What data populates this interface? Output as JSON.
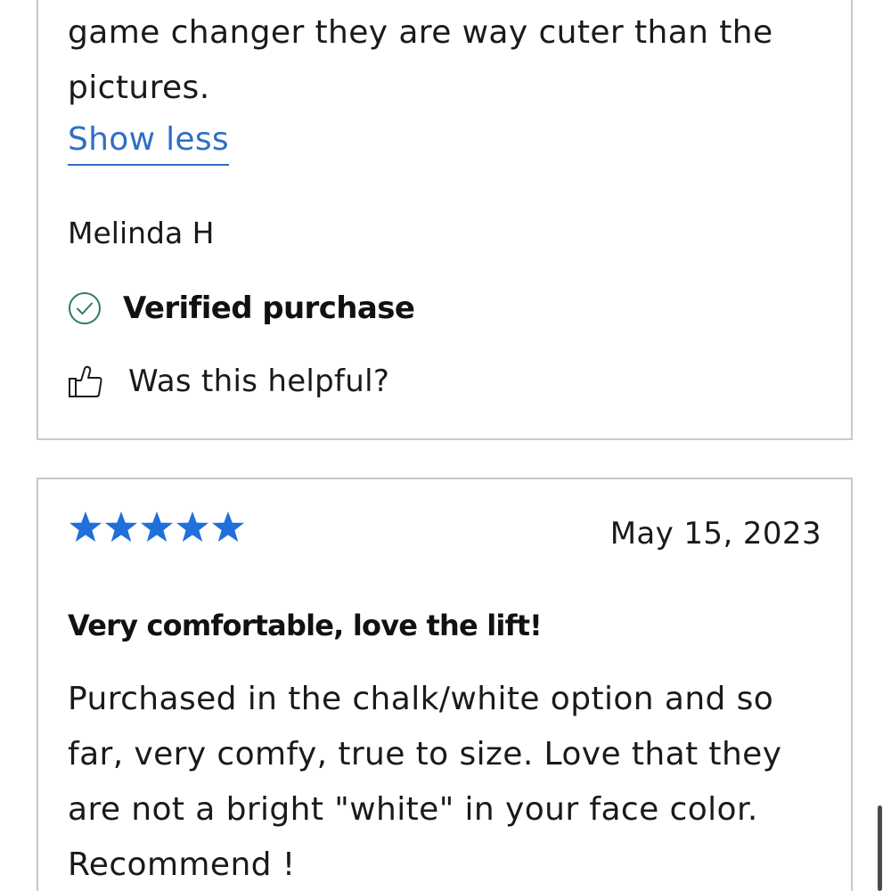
{
  "reviews": [
    {
      "body_tail": "game changer they are way cuter than the pictures.",
      "show_less_label": "Show less",
      "reviewer": "Melinda H",
      "verified_label": "Verified purchase",
      "helpful_label": "Was this helpful?",
      "icons": {
        "verified": "check-circle-icon",
        "helpful": "thumbs-up-icon"
      }
    },
    {
      "rating": 5,
      "rating_max": 5,
      "date": "May 15, 2023",
      "title": "Very comfortable, love the lift!",
      "body": "Purchased in the chalk/white option and so far, very comfy, true to size. Love that they are not a bright \"white\" in your face color. Recommend !"
    }
  ],
  "colors": {
    "link": "#2f6fc4",
    "star": "#1f6fdc",
    "verified_check": "#2e7d5b",
    "card_border": "#c9c9c9",
    "text": "#1a1a1a"
  }
}
